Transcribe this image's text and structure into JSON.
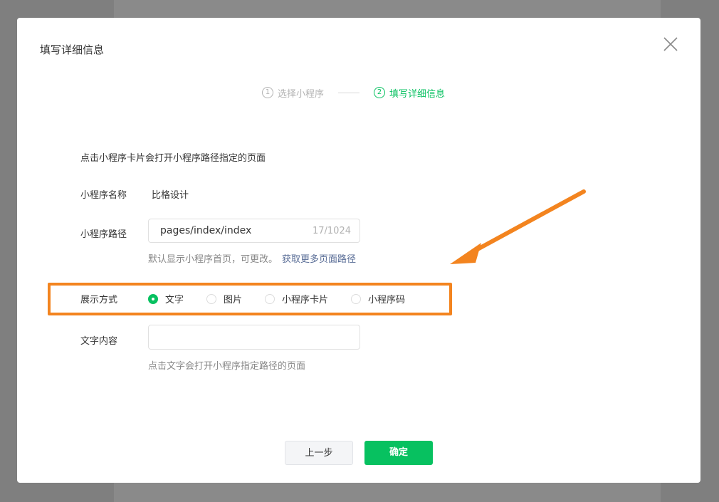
{
  "dialog": {
    "title": "填写详细信息"
  },
  "steps": [
    {
      "num": "1",
      "label": "选择小程序",
      "state": "inactive"
    },
    {
      "num": "2",
      "label": "填写详细信息",
      "state": "active"
    }
  ],
  "form": {
    "hint": "点击小程序卡片会打开小程序路径指定的页面",
    "name_label": "小程序名称",
    "name_value": "比格设计",
    "path_label": "小程序路径",
    "path_value": "pages/index/index",
    "path_count": "17/1024",
    "path_tip": "默认显示小程序首页，可更改。",
    "path_tip_link": "获取更多页面路径",
    "display_label": "展示方式",
    "display_options": [
      "文字",
      "图片",
      "小程序卡片",
      "小程序码"
    ],
    "display_selected": "文字",
    "text_label": "文字内容",
    "text_value": "",
    "text_tip": "点击文字会打开小程序指定路径的页面"
  },
  "buttons": {
    "prev": "上一步",
    "confirm": "确定"
  },
  "colors": {
    "accent": "#07c160",
    "highlight": "#f3841f",
    "link": "#576b95"
  }
}
